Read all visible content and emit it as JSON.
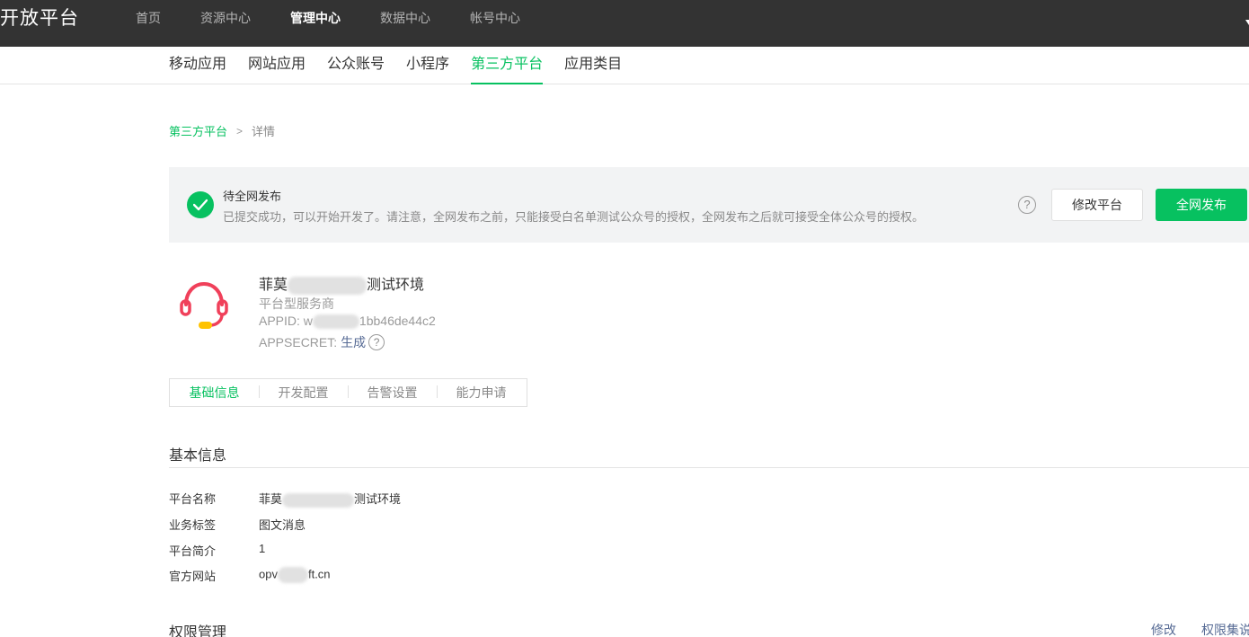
{
  "topbar": {
    "brand": "开放平台",
    "nav": [
      "首页",
      "资源中心",
      "管理中心",
      "数据中心",
      "帐号中心"
    ],
    "active_index": 2
  },
  "subnav": {
    "tabs": [
      "移动应用",
      "网站应用",
      "公众账号",
      "小程序",
      "第三方平台",
      "应用类目"
    ],
    "active_index": 4
  },
  "breadcrumb": {
    "parent": "第三方平台",
    "separator": ">",
    "current": "详情"
  },
  "banner": {
    "title": "待全网发布",
    "description": "已提交成功，可以开始开发了。请注意，全网发布之前，只能接受白名单测试公众号的授权，全网发布之后就可接受全体公众号的授权。",
    "help_symbol": "?",
    "modify_button": "修改平台",
    "publish_button": "全网发布"
  },
  "profile": {
    "name_start": "菲莫",
    "name_end": "测试环境",
    "type": "平台型服务商",
    "appid_label": "APPID: ",
    "appid_start": "w",
    "appid_end": "1bb46de44c2",
    "appsecret_label": "APPSECRET:",
    "appsecret_action": "生成",
    "help_symbol": "?"
  },
  "segment_tabs": [
    "基础信息",
    "开发配置",
    "告警设置",
    "能力申请"
  ],
  "basic_info": {
    "title": "基本信息",
    "rows": [
      {
        "label": "平台名称",
        "value_start": "菲莫",
        "value_end": "测试环境"
      },
      {
        "label": "业务标签",
        "value": "图文消息"
      },
      {
        "label": "平台简介",
        "value": "1"
      },
      {
        "label": "官方网站",
        "value_start": "opv",
        "value_end": "ft.cn"
      }
    ]
  },
  "permissions": {
    "title": "权限管理",
    "actions": [
      "修改",
      "权限集说"
    ]
  },
  "colors": {
    "accent": "#07c160",
    "topbar": "#333333",
    "link": "#576b95",
    "banner_bg": "#f2f3f4"
  }
}
